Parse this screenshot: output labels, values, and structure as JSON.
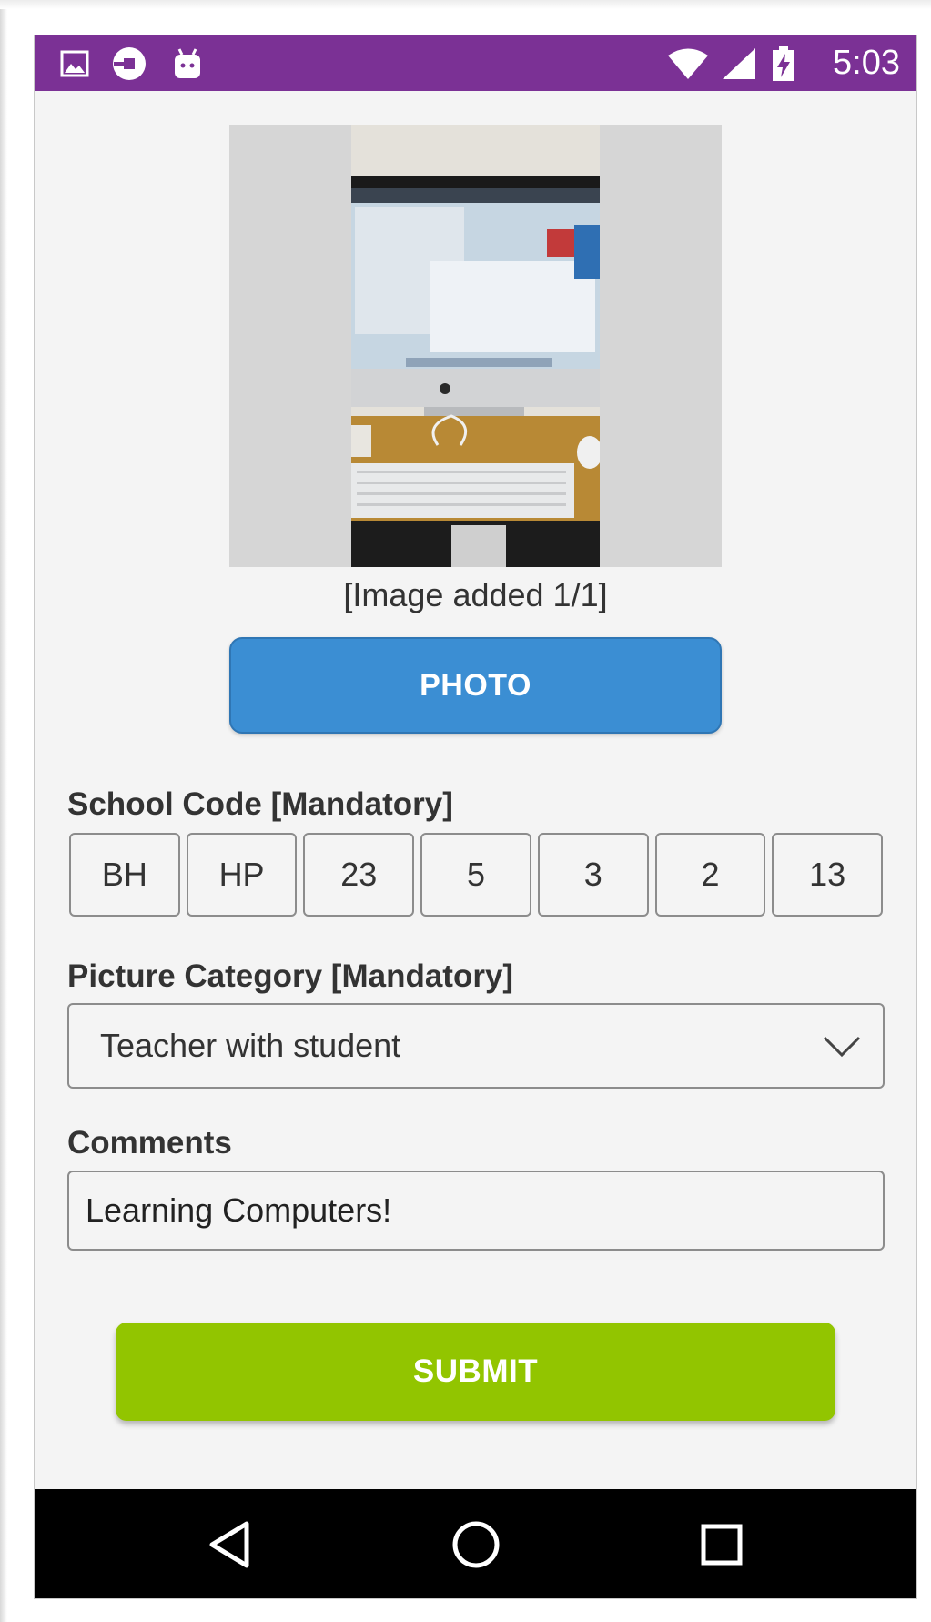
{
  "status_bar": {
    "time": "5:03",
    "left_icons": [
      "image-notification-icon",
      "uber-icon",
      "android-icon"
    ],
    "right_icons": [
      "wifi-icon",
      "signal-icon",
      "battery-charging-icon"
    ],
    "background": "#7b3195"
  },
  "photo": {
    "caption": "[Image added 1/1]",
    "button_label": "PHOTO",
    "button_color": "#3b8ed3"
  },
  "school_code": {
    "label": "School Code [Mandatory]",
    "segments": [
      "BH",
      "HP",
      "23",
      "5",
      "3",
      "2",
      "13"
    ]
  },
  "picture_category": {
    "label": "Picture Category [Mandatory]",
    "selected": "Teacher with student"
  },
  "comments": {
    "label": "Comments",
    "value": "Learning Computers!"
  },
  "submit": {
    "label": "SUBMIT",
    "color": "#92c500"
  },
  "nav_bar": {
    "buttons": [
      "back-icon",
      "home-icon",
      "recents-icon"
    ]
  }
}
